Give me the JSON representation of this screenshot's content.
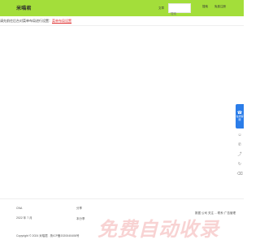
{
  "header": {
    "logo": "米喵君",
    "search_scope": "文章",
    "search_placeholder": "搜索",
    "search_button": "搜索",
    "register_link": "免费注册"
  },
  "notice": {
    "text": "请先前往后台对菜单布局进行设置：",
    "link": "菜单布局设置"
  },
  "sidebar": {
    "main_label": "在线客服",
    "icons": [
      "chat-icon",
      "phone-icon",
      "share-icon",
      "refresh-icon",
      "trash-icon",
      "top-icon"
    ]
  },
  "side_text": "数据 公司 关注 ... 联系·广告管理",
  "footer": {
    "col_a": [
      "CNA",
      "2022 年 7 月"
    ],
    "col_b": [
      "分享",
      "本分享"
    ],
    "copyright": "Copyright © 2024 米喵君 . 鲁ICP备2020040406号"
  },
  "watermark": "免费自动收录"
}
